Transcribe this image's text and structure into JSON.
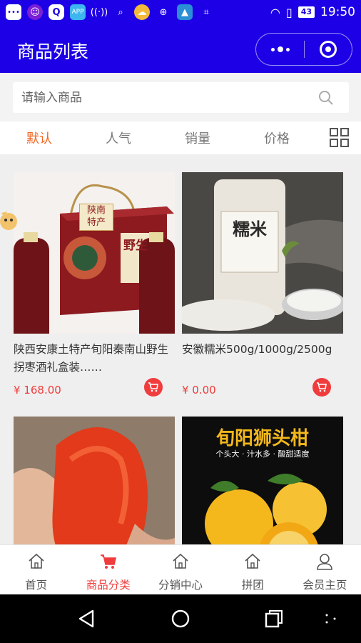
{
  "status_bar": {
    "time": "19:50",
    "battery": "43"
  },
  "nav": {
    "title": "商品列表"
  },
  "search": {
    "placeholder": "请输入商品"
  },
  "sort_tabs": [
    {
      "label": "默认",
      "active": true
    },
    {
      "label": "人气",
      "active": false
    },
    {
      "label": "销量",
      "active": false
    },
    {
      "label": "价格",
      "active": false
    }
  ],
  "products": [
    {
      "name": "陕西安康土特产旬阳秦南山野生拐枣酒礼盒装……",
      "price": "¥ 168.00",
      "box_top": "陕南",
      "box_mid": "特产",
      "box_label": "野生"
    },
    {
      "name": "安徽糯米500g/1000g/2500g",
      "price": "¥ 0.00",
      "bag_text": "糯米"
    },
    {
      "name": "",
      "price": ""
    },
    {
      "name": "",
      "price": "",
      "banner_title": "旬阳狮头柑",
      "banner_sub": "个头大 · 汁水多 · 酸甜适度"
    }
  ],
  "tabbar": [
    {
      "label": "首页",
      "icon": "home-icon",
      "active": false
    },
    {
      "label": "商品分类",
      "icon": "cart-icon",
      "active": true
    },
    {
      "label": "分销中心",
      "icon": "home-icon",
      "active": false
    },
    {
      "label": "拼团",
      "icon": "home-icon",
      "active": false
    },
    {
      "label": "会员主页",
      "icon": "user-icon",
      "active": false
    }
  ],
  "colors": {
    "brand": "#1d00e6",
    "accent": "#f26522",
    "price": "#f03c3c"
  }
}
